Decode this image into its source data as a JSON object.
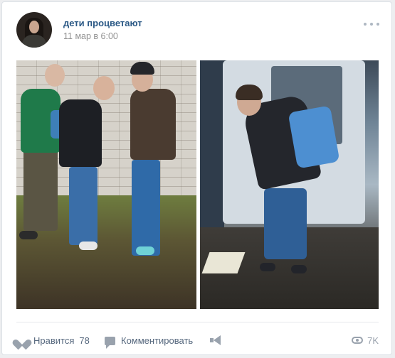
{
  "post": {
    "author": "дети процветают",
    "date": "11 мар в 6:00"
  },
  "footer": {
    "like_label": "Нравится",
    "like_count": "78",
    "comment_label": "Комментировать",
    "views": "7K"
  },
  "icons": {
    "like": "heart-icon",
    "comment": "comment-icon",
    "share": "megaphone-icon",
    "views": "eye-icon",
    "more": "more-icon"
  },
  "colors": {
    "author_link": "#2a5885",
    "meta_text": "#939393",
    "action_text": "#55677d",
    "icon": "#99a2ad",
    "background": "#edeef0"
  }
}
